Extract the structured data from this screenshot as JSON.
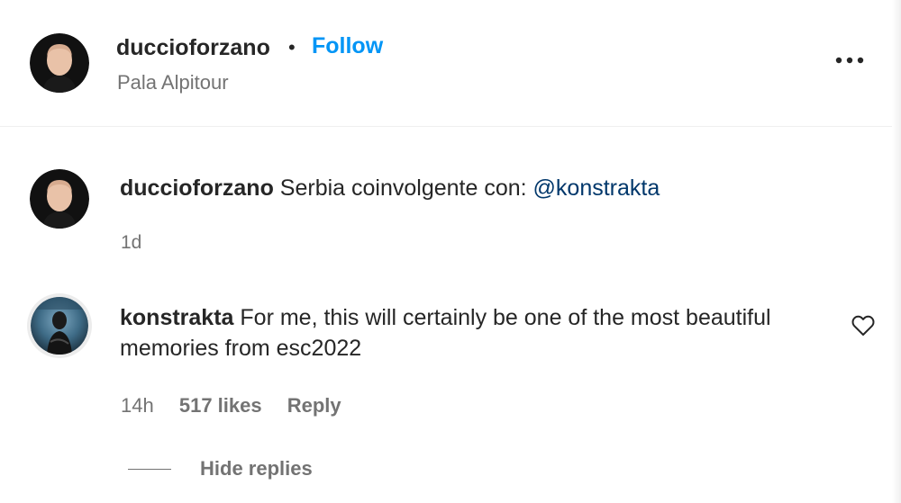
{
  "post_header": {
    "username": "duccioforzano",
    "separator": "•",
    "follow_label": "Follow",
    "location": "Pala Alpitour",
    "more_icon": "more-horizontal-icon"
  },
  "caption": {
    "username": "duccioforzano",
    "text": "Serbia coinvolgente con: ",
    "mention": "@konstrakta",
    "time": "1d"
  },
  "reply": {
    "username": "konstrakta",
    "text": "For me, this will certainly be one of the most beautiful memories from esc2022",
    "time": "14h",
    "likes": "517 likes",
    "reply_label": "Reply",
    "like_icon": "heart-outline-icon"
  },
  "thread": {
    "hide_replies_label": "Hide replies"
  },
  "colors": {
    "accent": "#0095f6",
    "mention": "#00376b",
    "secondary_text": "#737373",
    "primary_text": "#262626"
  }
}
